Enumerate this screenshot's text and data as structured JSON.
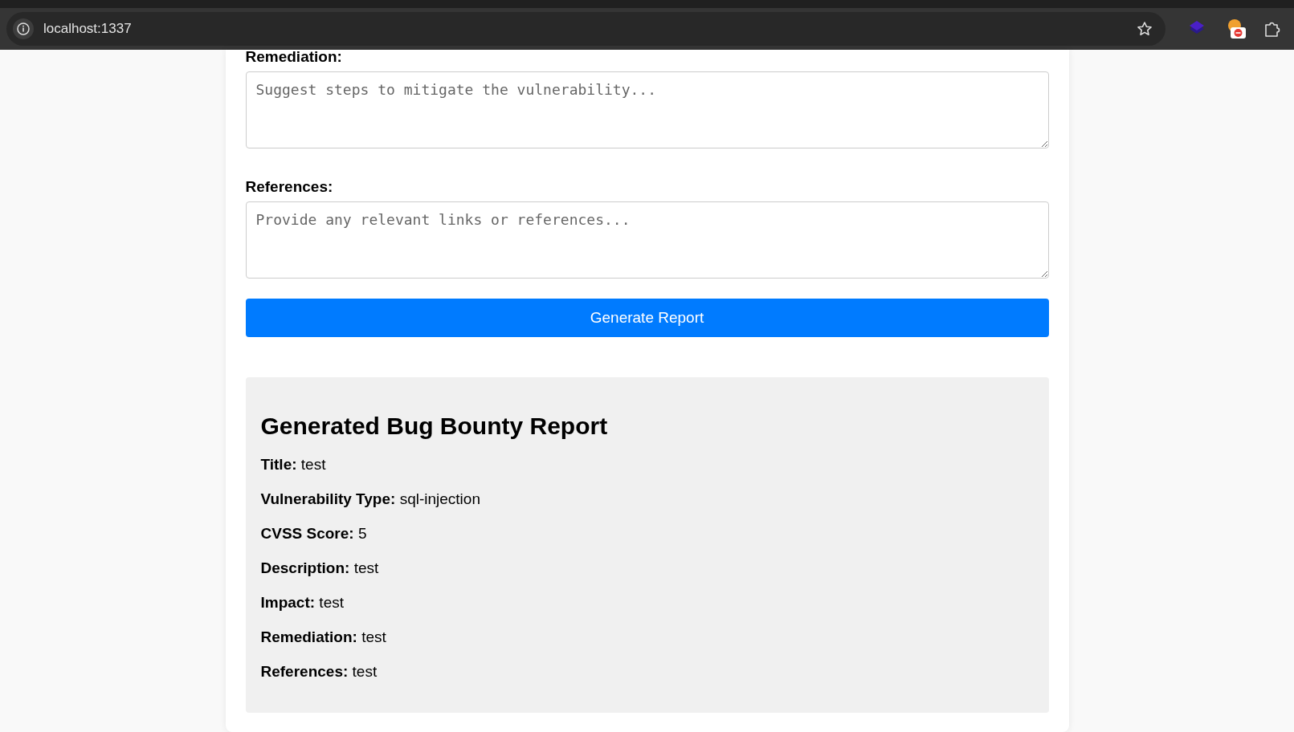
{
  "browser": {
    "url": "localhost:1337"
  },
  "form": {
    "fields": [
      {
        "label": "Remediation:",
        "placeholder": "Suggest steps to mitigate the vulnerability..."
      },
      {
        "label": "References:",
        "placeholder": "Provide any relevant links or references..."
      }
    ],
    "submit": "Generate Report"
  },
  "report": {
    "heading": "Generated Bug Bounty Report",
    "lines": [
      "**Title:** test",
      "**Vulnerability Type:** sql-injection",
      "**CVSS Score:** 5",
      "**Description:** test",
      "**Impact:** test",
      "**Remediation:** test",
      "**References:** test"
    ]
  }
}
